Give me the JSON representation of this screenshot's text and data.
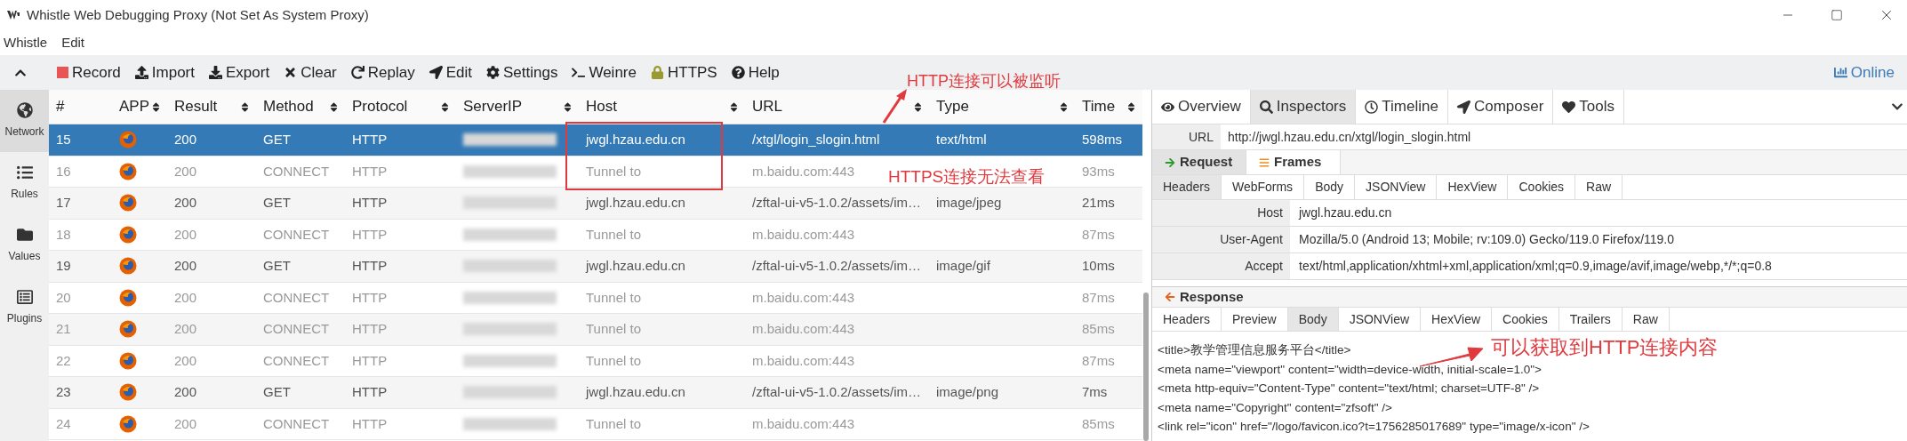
{
  "window": {
    "title": "Whistle Web Debugging Proxy (Not Set As System Proxy)"
  },
  "menu": [
    "Whistle",
    "Edit"
  ],
  "toolbar": {
    "items": [
      {
        "label": "Record"
      },
      {
        "label": "Import"
      },
      {
        "label": "Export"
      },
      {
        "label": "Clear"
      },
      {
        "label": "Replay"
      },
      {
        "label": "Edit"
      },
      {
        "label": "Settings"
      },
      {
        "label": "Weinre"
      },
      {
        "label": "HTTPS"
      },
      {
        "label": "Help"
      }
    ],
    "online": "Online"
  },
  "sidebar": {
    "items": [
      {
        "label": "Network",
        "selected": true
      },
      {
        "label": "Rules",
        "selected": false
      },
      {
        "label": "Values",
        "selected": false
      },
      {
        "label": "Plugins",
        "selected": false
      }
    ]
  },
  "table": {
    "columns": [
      "#",
      "APP",
      "Result",
      "Method",
      "Protocol",
      "ServerIP",
      "Host",
      "URL",
      "Type",
      "Time"
    ],
    "rows": [
      {
        "number": "15",
        "result": "200",
        "method": "GET",
        "protocol": "HTTP",
        "host": "jwgl.hzau.edu.cn",
        "url": "/xtgl/login_slogin.html",
        "type": "text/html",
        "time": "598ms",
        "selected": true,
        "dimmed": false
      },
      {
        "number": "16",
        "result": "200",
        "method": "CONNECT",
        "protocol": "HTTP",
        "host": "Tunnel to",
        "url": "m.baidu.com:443",
        "time": "93ms",
        "selected": false,
        "dimmed": true
      },
      {
        "number": "17",
        "result": "200",
        "method": "GET",
        "protocol": "HTTP",
        "host": "jwgl.hzau.edu.cn",
        "url": "/zftal-ui-v5-1.0.2/assets/im…",
        "type": "image/jpeg",
        "time": "21ms",
        "selected": false,
        "dimmed": false
      },
      {
        "number": "18",
        "result": "200",
        "method": "CONNECT",
        "protocol": "HTTP",
        "host": "Tunnel to",
        "url": "m.baidu.com:443",
        "time": "87ms",
        "selected": false,
        "dimmed": true
      },
      {
        "number": "19",
        "result": "200",
        "method": "GET",
        "protocol": "HTTP",
        "host": "jwgl.hzau.edu.cn",
        "url": "/zftal-ui-v5-1.0.2/assets/im…",
        "type": "image/gif",
        "time": "10ms",
        "selected": false,
        "dimmed": false
      },
      {
        "number": "20",
        "result": "200",
        "method": "CONNECT",
        "protocol": "HTTP",
        "host": "Tunnel to",
        "url": "m.baidu.com:443",
        "time": "87ms",
        "selected": false,
        "dimmed": true
      },
      {
        "number": "21",
        "result": "200",
        "method": "CONNECT",
        "protocol": "HTTP",
        "host": "Tunnel to",
        "url": "m.baidu.com:443",
        "time": "85ms",
        "selected": false,
        "dimmed": true
      },
      {
        "number": "22",
        "result": "200",
        "method": "CONNECT",
        "protocol": "HTTP",
        "host": "Tunnel to",
        "url": "m.baidu.com:443",
        "time": "87ms",
        "selected": false,
        "dimmed": true
      },
      {
        "number": "23",
        "result": "200",
        "method": "GET",
        "protocol": "HTTP",
        "host": "jwgl.hzau.edu.cn",
        "url": "/zftal-ui-v5-1.0.2/assets/im…",
        "type": "image/png",
        "time": "7ms",
        "selected": false,
        "dimmed": false
      },
      {
        "number": "24",
        "result": "200",
        "method": "CONNECT",
        "protocol": "HTTP",
        "host": "Tunnel to",
        "url": "m.baidu.com:443",
        "time": "85ms",
        "selected": false,
        "dimmed": true
      }
    ]
  },
  "inspector": {
    "tabs": [
      {
        "label": "Overview",
        "selected": false
      },
      {
        "label": "Inspectors",
        "selected": true
      },
      {
        "label": "Timeline",
        "selected": false
      },
      {
        "label": "Composer",
        "selected": false
      },
      {
        "label": "Tools",
        "selected": false
      }
    ],
    "url_label": "URL",
    "url": "http://jwgl.hzau.edu.cn/xtgl/login_slogin.html",
    "request_tabs": [
      {
        "label": "Request",
        "selected": true
      },
      {
        "label": "Frames",
        "selected": false
      }
    ],
    "request_subtabs": [
      {
        "label": "Headers",
        "selected": true
      },
      {
        "label": "WebForms",
        "selected": false
      },
      {
        "label": "Body",
        "selected": false
      },
      {
        "label": "JSONView",
        "selected": false
      },
      {
        "label": "HexView",
        "selected": false
      },
      {
        "label": "Cookies",
        "selected": false
      },
      {
        "label": "Raw",
        "selected": false
      }
    ],
    "headers": [
      {
        "name": "Host",
        "value": "jwgl.hzau.edu.cn"
      },
      {
        "name": "User-Agent",
        "value": "Mozilla/5.0 (Android 13; Mobile; rv:109.0) Gecko/119.0 Firefox/119.0"
      },
      {
        "name": "Accept",
        "value": "text/html,application/xhtml+xml,application/xml;q=0.9,image/avif,image/webp,*/*;q=0.8"
      }
    ],
    "response_title": "Response",
    "response_tabs": [
      {
        "label": "Headers",
        "selected": false
      },
      {
        "label": "Preview",
        "selected": false
      },
      {
        "label": "Body",
        "selected": true
      },
      {
        "label": "JSONView",
        "selected": false
      },
      {
        "label": "HexView",
        "selected": false
      },
      {
        "label": "Cookies",
        "selected": false
      },
      {
        "label": "Trailers",
        "selected": false
      },
      {
        "label": "Raw",
        "selected": false
      }
    ],
    "body_lines": [
      "<title>教学管理信息服务平台</title>",
      "<meta name=\"viewport\" content=\"width=device-width, initial-scale=1.0\">",
      "<meta http-equiv=\"Content-Type\" content=\"text/html; charset=UTF-8\" />",
      "<meta name=\"Copyright\" content=\"zfsoft\" />",
      "<link rel=\"icon\" href=\"/logo/favicon.ico?t=1756285017689\" type=\"image/x-icon\" />"
    ]
  },
  "annotations": [
    "HTTP连接可以被监听",
    "HTTPS连接无法查看",
    "可以获取到HTTP连接内容"
  ]
}
